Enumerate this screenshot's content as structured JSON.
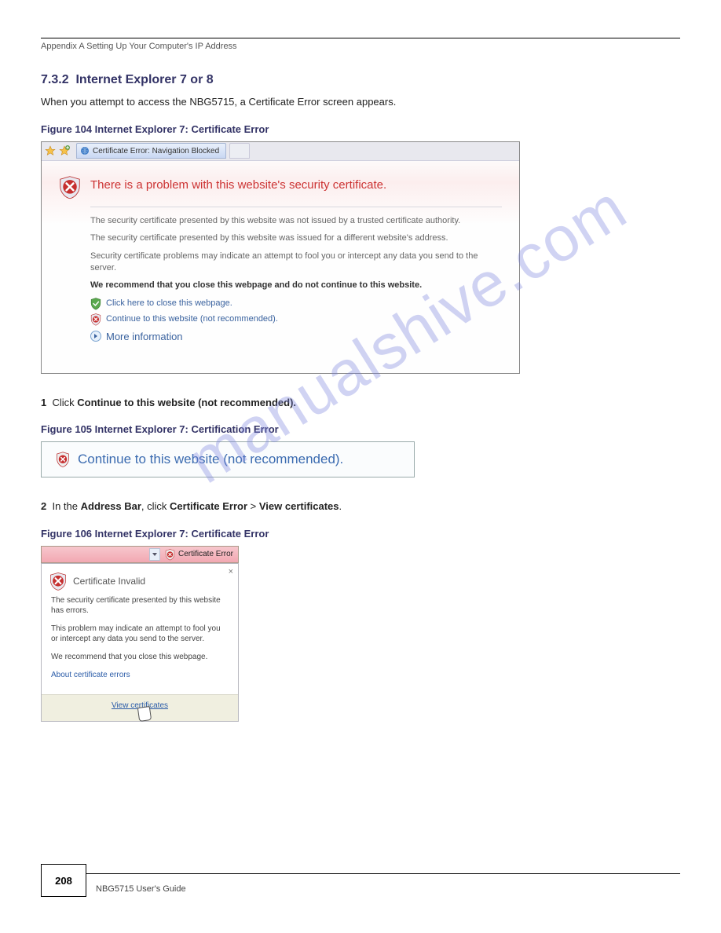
{
  "header": {
    "appendix_label": "Appendix A Setting Up Your Computer's IP Address"
  },
  "section": {
    "heading_number": "7.3.2",
    "heading_text": "Internet Explorer 7 or 8",
    "intro": "When you attempt to access the NBG5715, a Certificate Error screen appears.",
    "fig1_caption": "Figure 104   Internet Explorer 7: Certificate Error",
    "step1": "Click Continue to this website (not recommended).",
    "fig2_caption": "Figure 105   Internet Explorer 7: Certification Error",
    "step2_prefix": "In the Address Bar, click Certificate Error > View certificates.",
    "fig3_caption": "Figure 106   Internet Explorer 7: Certificate Error"
  },
  "ie_page": {
    "tab_title": "Certificate Error: Navigation Blocked",
    "title": "There is a problem with this website's security certificate.",
    "para1": "The security certificate presented by this website was not issued by a trusted certificate authority.",
    "para2": "The security certificate presented by this website was issued for a different website's address.",
    "para3": "Security certificate problems may indicate an attempt to fool you or intercept any data you send to the server.",
    "recommend": "We recommend that you close this webpage and do not continue to this website.",
    "close_link": "Click here to close this webpage.",
    "continue_link": "Continue to this website (not recommended).",
    "more_info": "More information"
  },
  "continue_box": {
    "text": "Continue to this website (not recommended)."
  },
  "popup": {
    "bar_text": "Certificate Error",
    "title": "Certificate Invalid",
    "p1": "The security certificate presented by this website has errors.",
    "p2": "This problem may indicate an attempt to fool you or intercept any data you send to the server.",
    "p3": "We recommend that you close this webpage.",
    "about_link": "About certificate errors",
    "view_link": "View certificates"
  },
  "footer": {
    "page": "208",
    "guide": "NBG5715 User's Guide"
  },
  "watermark": "manualshive.com"
}
